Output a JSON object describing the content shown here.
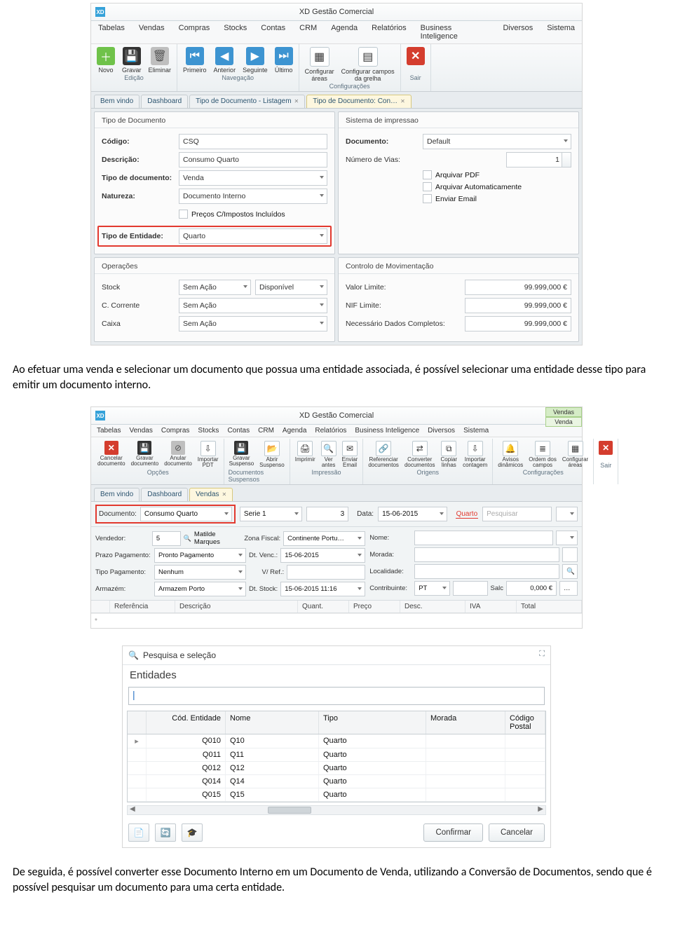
{
  "s1": {
    "winTitle": "XD Gestão Comercial",
    "menus": [
      "Tabelas",
      "Vendas",
      "Compras",
      "Stocks",
      "Contas",
      "CRM",
      "Agenda",
      "Relatórios",
      "Business Inteligence",
      "Diversos",
      "Sistema"
    ],
    "groups": {
      "edicao": {
        "label": "Edição",
        "novo": "Novo",
        "gravar": "Gravar",
        "eliminar": "Eliminar"
      },
      "nav": {
        "label": "Navegação",
        "primeiro": "Primeiro",
        "anterior": "Anterior",
        "seguinte": "Seguinte",
        "ultimo": "Último"
      },
      "cfg": {
        "label": "Configurações",
        "areas": "Configurar\náreas",
        "grelha": "Configurar campos\nda grelha"
      },
      "sair": {
        "label": "Sair"
      }
    },
    "tabs": [
      "Bem vindo",
      "Dashboard",
      "Tipo de Documento - Listagem",
      "Tipo de Documento: Con…"
    ],
    "left": {
      "title": "Tipo de Documento",
      "codigo_l": "Código:",
      "codigo_v": "CSQ",
      "descr_l": "Descrição:",
      "descr_v": "Consumo Quarto",
      "tipo_l": "Tipo de documento:",
      "tipo_v": "Venda",
      "nat_l": "Natureza:",
      "nat_v": "Documento Interno",
      "precos": "Preços C/Impostos Incluídos",
      "ent_l": "Tipo de Entidade:",
      "ent_v": "Quarto"
    },
    "right": {
      "title": "Sistema de impressao",
      "doc_l": "Documento:",
      "doc_v": "Default",
      "vias_l": "Número de Vias:",
      "vias_v": "1",
      "arq_pdf": "Arquivar PDF",
      "arq_auto": "Arquivar Automaticamente",
      "email": "Enviar Email"
    },
    "op": {
      "title": "Operações",
      "stock": "Stock",
      "cc": "C. Corrente",
      "caixa": "Caixa",
      "sem": "Sem Ação",
      "disp": "Disponível"
    },
    "mov": {
      "title": "Controlo de Movimentação",
      "vl": "Valor Limite:",
      "nl": "NIF Limite:",
      "nd": "Necessário Dados Completos:",
      "val": "99.999,000 €"
    }
  },
  "para1": "Ao efetuar uma venda e selecionar um documento que possua uma entidade associada, é possível selecionar uma entidade desse tipo para emitir um documento interno.",
  "s2": {
    "winTitle": "XD Gestão Comercial",
    "corner": [
      "Vendas",
      "Venda"
    ],
    "menus": [
      "Tabelas",
      "Vendas",
      "Compras",
      "Stocks",
      "Contas",
      "CRM",
      "Agenda",
      "Relatórios",
      "Business Inteligence",
      "Diversos",
      "Sistema"
    ],
    "rb": [
      {
        "l": "Cancelar\ndocumento"
      },
      {
        "l": "Gravar\ndocumento"
      },
      {
        "l": "Anular\ndocumento"
      },
      {
        "l": "Importar\nPDT"
      },
      {
        "l": "Gravar\nSuspenso"
      },
      {
        "l": "Abrir\nSuspenso"
      },
      {
        "l": "Documentos Suspensos"
      },
      {
        "l": "Imprimir"
      },
      {
        "l": "Ver\nantes"
      },
      {
        "l": "Enviar\nEmail"
      },
      {
        "l": "Referenciar\ndocumentos"
      },
      {
        "l": "Converter\ndocumentos"
      },
      {
        "l": "Copiar\nlinhas"
      },
      {
        "l": "Importar\ncontagem"
      },
      {
        "l": "Avisos\ndinâmicos"
      },
      {
        "l": "Ordem dos\ncampos"
      },
      {
        "l": "Configurar\náreas"
      }
    ],
    "rgroups": [
      "Opções",
      "",
      "Impressão",
      "Origens",
      "Configurações",
      "Sair"
    ],
    "tabs": [
      "Bem vindo",
      "Dashboard",
      "Vendas"
    ],
    "docbar": {
      "doc_l": "Documento:",
      "doc_v": "Consumo Quarto",
      "serie": "Serie 1",
      "num": "3",
      "data_l": "Data:",
      "data_v": "15-06-2015",
      "quarto": "Quarto",
      "pesq": "Pesquisar"
    },
    "form": {
      "vend_l": "Vendedor:",
      "vend_v": "5",
      "vend_n": "Matilde Marques",
      "zf_l": "Zona Fiscal:",
      "zf_v": "Continente Portu…",
      "pp_l": "Prazo Pagamento:",
      "pp_v": "Pronto Pagamento",
      "dv_l": "Dt. Venc.:",
      "dv_v": "15-06-2015",
      "tp_l": "Tipo Pagamento:",
      "tp_v": "Nenhum",
      "vr_l": "V/ Ref.:",
      "arm_l": "Armazém:",
      "arm_v": "Armazem Porto",
      "ds_l": "Dt. Stock:",
      "ds_v": "15-06-2015 11:16",
      "nome_l": "Nome:",
      "mor_l": "Morada:",
      "loc_l": "Localidade:",
      "con_l": "Contribuinte:",
      "con_v": "PT",
      "salc_l": "Salc",
      "salc_v": "0,000 €"
    },
    "cols": [
      "Referência",
      "Descrição",
      "Quant.",
      "Preço",
      "Desc.",
      "IVA",
      "Total"
    ]
  },
  "s3": {
    "title": "Pesquisa e seleção",
    "sub": "Entidades",
    "cols": [
      "Cód. Entidade",
      "Nome",
      "Tipo",
      "Morada",
      "Código Postal"
    ],
    "rows": [
      {
        "c": "Q010",
        "n": "Q10",
        "t": "Quarto"
      },
      {
        "c": "Q011",
        "n": "Q11",
        "t": "Quarto"
      },
      {
        "c": "Q012",
        "n": "Q12",
        "t": "Quarto"
      },
      {
        "c": "Q014",
        "n": "Q14",
        "t": "Quarto"
      },
      {
        "c": "Q015",
        "n": "Q15",
        "t": "Quarto"
      }
    ],
    "confirm": "Confirmar",
    "cancel": "Cancelar"
  },
  "para2": "De seguida, é possível converter esse Documento Interno em um Documento de Venda, utilizando a Conversão de Documentos, sendo que é possível pesquisar um documento para uma certa entidade."
}
